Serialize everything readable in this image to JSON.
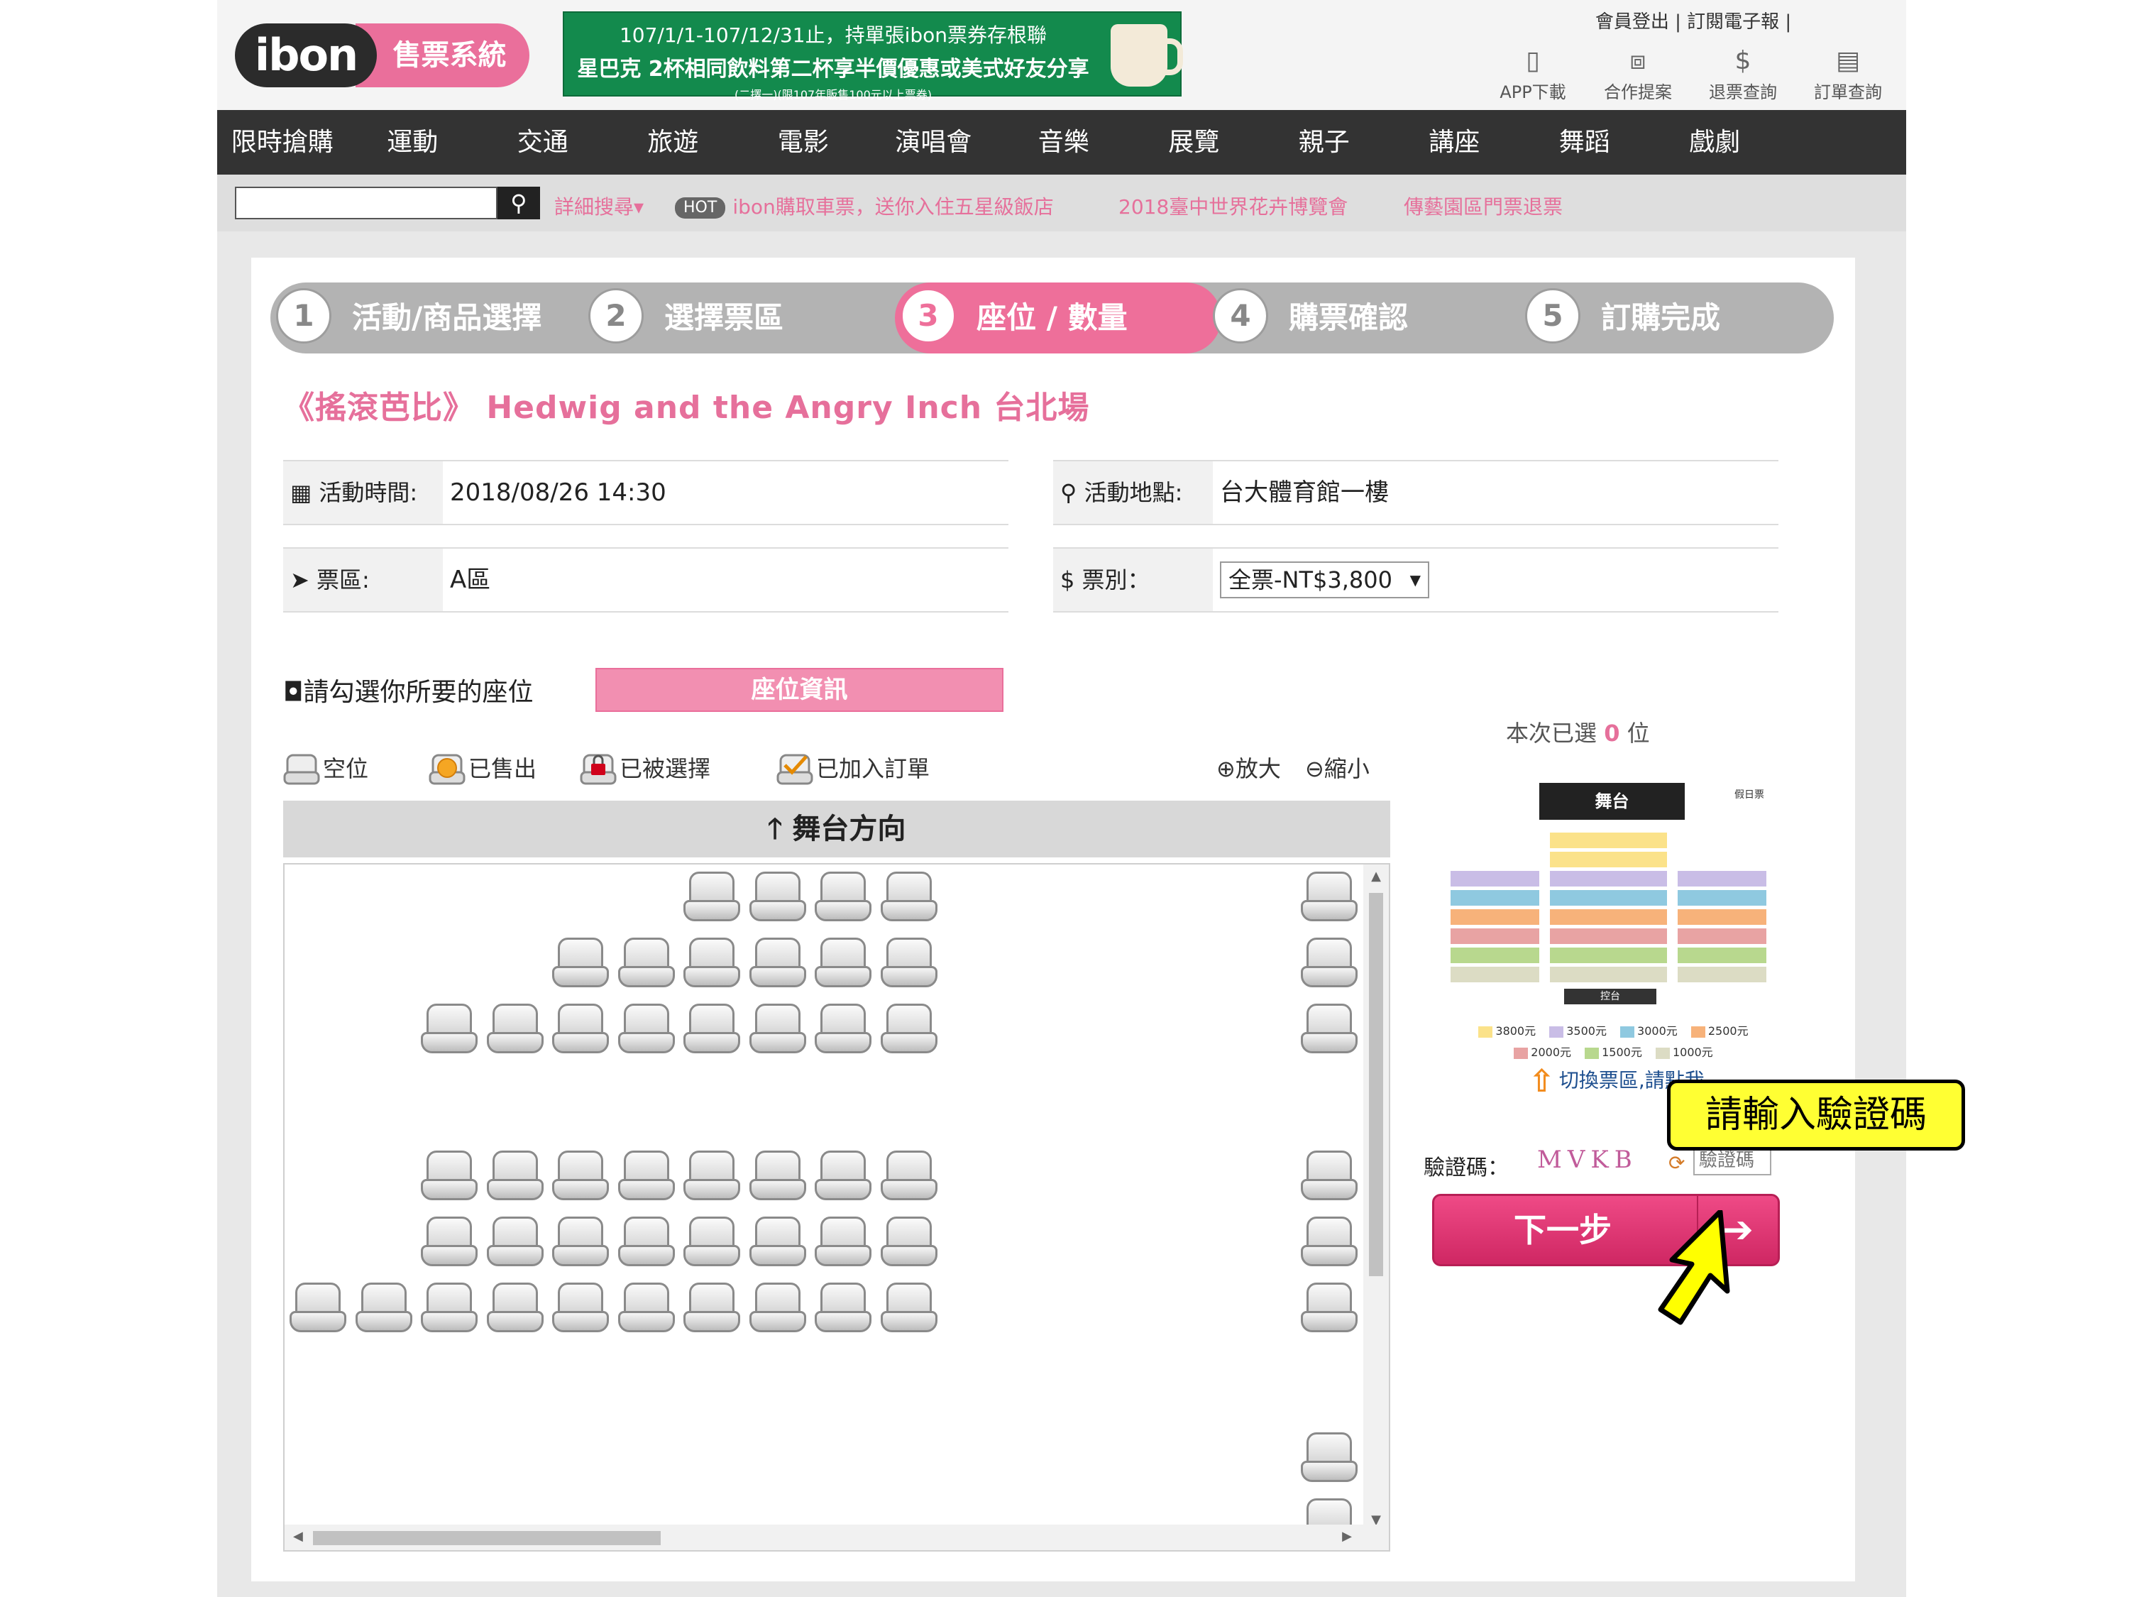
{
  "header": {
    "logo_main": "ibon",
    "logo_sub": "售票系統",
    "promo": {
      "line1": "107/1/1-107/12/31止，持單張ibon票券存根聯",
      "line2": "星巴克 2杯相同飲料第二杯享半價優惠或美式好友分享",
      "line3": "(二擇一)(限107年販售100元以上票券)"
    },
    "top_links": [
      "會員登出",
      "訂閱電子報"
    ],
    "quick_links": [
      {
        "label": "APP下載",
        "icon": "phone-icon"
      },
      {
        "label": "合作提案",
        "icon": "briefcase-icon"
      },
      {
        "label": "退票查詢",
        "icon": "refund-icon"
      },
      {
        "label": "訂單查詢",
        "icon": "document-icon"
      }
    ]
  },
  "nav": [
    "限時搶購",
    "運動",
    "交通",
    "旅遊",
    "電影",
    "演唱會",
    "音樂",
    "展覽",
    "親子",
    "講座",
    "舞蹈",
    "戲劇"
  ],
  "search": {
    "value": "",
    "advanced_label": "詳細搜尋",
    "hot_badge": "HOT",
    "hot_links": [
      "ibon購取車票，送你入住五星級飯店",
      "2018臺中世界花卉博覽會",
      "傳藝園區門票退票"
    ]
  },
  "steps": [
    {
      "num": "1",
      "label": "活動/商品選擇"
    },
    {
      "num": "2",
      "label": "選擇票區"
    },
    {
      "num": "3",
      "label": "座位 / 數量"
    },
    {
      "num": "4",
      "label": "購票確認"
    },
    {
      "num": "5",
      "label": "訂購完成"
    }
  ],
  "event": {
    "title": "《搖滾芭比》 Hedwig and the Angry Inch 台北場",
    "time_label": "活動時間:",
    "time_value": "2018/08/26 14:30",
    "venue_label": "活動地點:",
    "venue_value": "台大體育館一樓",
    "zone_label": "票區:",
    "zone_value": "A區",
    "ticket_label": "票別：",
    "ticket_value": "全票-NT$3,800"
  },
  "seat_section": {
    "pick_label": "請勾選你所要的座位",
    "seat_info_button": "座位資訊",
    "legend": [
      "空位",
      "已售出",
      "已被選擇",
      "已加入訂單"
    ],
    "zoom_in": "放大",
    "zoom_out": "縮小",
    "stage_direction": "舞台方向"
  },
  "right": {
    "selected_prefix": "本次已選",
    "selected_count": "0",
    "selected_suffix": "位",
    "map_stage": "舞台",
    "map_tag": "假日票",
    "map_control": "控台",
    "price_legend": [
      {
        "label": "3800元",
        "color": "#fbe28a"
      },
      {
        "label": "3500元",
        "color": "#c9bde6"
      },
      {
        "label": "3000元",
        "color": "#8fc9e0"
      },
      {
        "label": "2500元",
        "color": "#f7b27a"
      },
      {
        "label": "2000元",
        "color": "#e8a3a3"
      },
      {
        "label": "1500元",
        "color": "#b8d88e"
      },
      {
        "label": "1000元",
        "color": "#dcdcc4"
      }
    ],
    "switch_zone": "切換票區,請點我",
    "captcha_label": "驗證碼：",
    "captcha_text": "MVKB",
    "captcha_placeholder": "驗證碼",
    "next_button": "下一步",
    "callout": "請輸入驗證碼"
  }
}
